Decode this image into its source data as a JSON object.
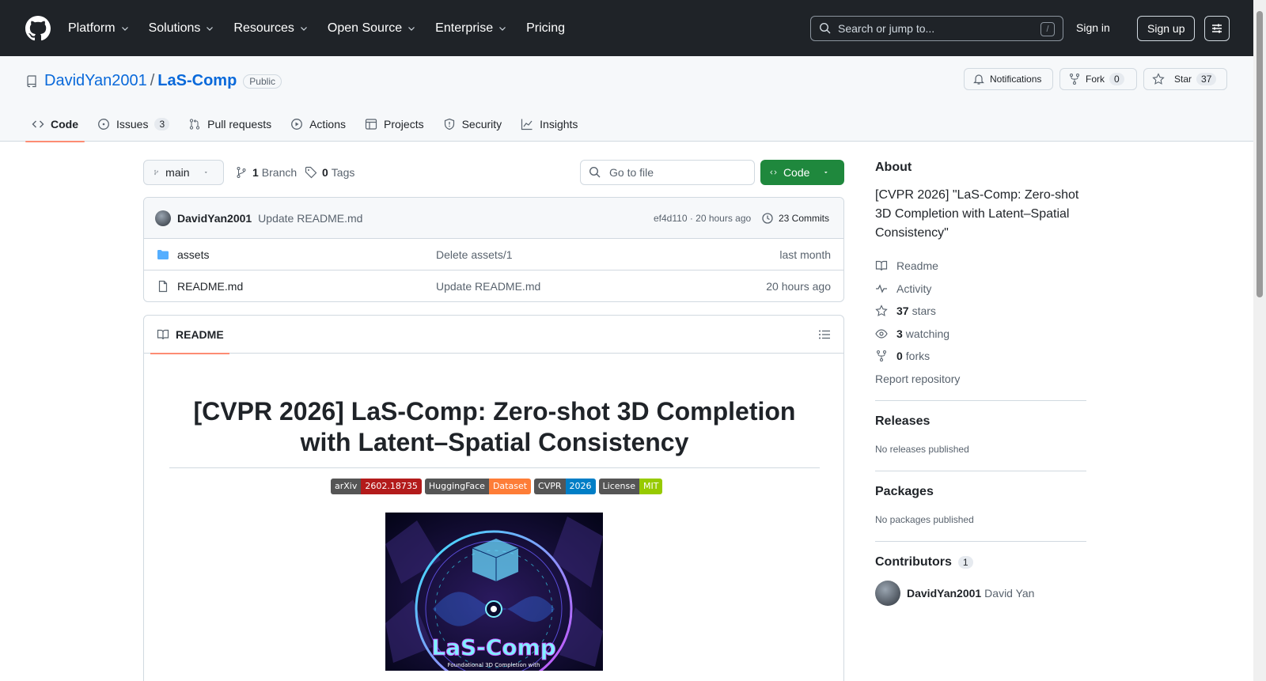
{
  "header": {
    "nav": [
      "Platform",
      "Solutions",
      "Resources",
      "Open Source",
      "Enterprise",
      "Pricing"
    ],
    "search_placeholder": "Search or jump to...",
    "search_shortcut": "/",
    "signin": "Sign in",
    "signup": "Sign up"
  },
  "repo": {
    "owner": "DavidYan2001",
    "separator": "/",
    "name": "LaS-Comp",
    "visibility": "Public",
    "notifications": "Notifications",
    "fork_label": "Fork",
    "fork_count": "0",
    "star_label": "Star",
    "star_count": "37"
  },
  "tabs": [
    {
      "label": "Code",
      "icon": "code-icon"
    },
    {
      "label": "Issues",
      "count": "3",
      "icon": "issue-icon"
    },
    {
      "label": "Pull requests",
      "icon": "pull-request-icon"
    },
    {
      "label": "Actions",
      "icon": "play-icon"
    },
    {
      "label": "Projects",
      "icon": "table-icon"
    },
    {
      "label": "Security",
      "icon": "shield-icon"
    },
    {
      "label": "Insights",
      "icon": "graph-icon"
    }
  ],
  "toolbar": {
    "branch": "main",
    "branch_count": "1",
    "branch_label": "Branch",
    "tag_count": "0",
    "tag_label": "Tags",
    "goto_placeholder": "Go to file",
    "code_button": "Code"
  },
  "latest_commit": {
    "author": "DavidYan2001",
    "message": "Update README.md",
    "hash_time": "ef4d110 · 20 hours ago",
    "commits": "23 Commits"
  },
  "files": [
    {
      "name": "assets",
      "type": "folder",
      "message": "Delete assets/1",
      "date": "last month"
    },
    {
      "name": "README.md",
      "type": "file",
      "message": "Update README.md",
      "date": "20 hours ago"
    }
  ],
  "readme": {
    "tab": "README",
    "title": "[CVPR 2026] LaS-Comp: Zero-shot 3D Completion with Latent–Spatial Consistency",
    "badges": [
      {
        "left": "arXiv",
        "right": "2602.18735",
        "color": "#b31b1b"
      },
      {
        "left": "HuggingFace",
        "right": "Dataset",
        "color": "#fe7d37"
      },
      {
        "left": "CVPR",
        "right": "2026",
        "color": "#007ec6"
      },
      {
        "left": "License",
        "right": "MIT",
        "color": "#97ca00"
      }
    ],
    "hero_text": "LaS-Comp",
    "hero_subtext": "Foundational 3D Completion with"
  },
  "about": {
    "heading": "About",
    "description": "[CVPR 2026] \"LaS-Comp: Zero-shot 3D Completion with Latent–Spatial Consistency\"",
    "readme": "Readme",
    "activity": "Activity",
    "stars_count": "37",
    "stars_label": "stars",
    "watching_count": "3",
    "watching_label": "watching",
    "forks_count": "0",
    "forks_label": "forks",
    "report": "Report repository"
  },
  "releases": {
    "heading": "Releases",
    "text": "No releases published"
  },
  "packages": {
    "heading": "Packages",
    "text": "No packages published"
  },
  "contributors": {
    "heading": "Contributors",
    "count": "1",
    "login": "DavidYan2001",
    "name": "David Yan"
  }
}
